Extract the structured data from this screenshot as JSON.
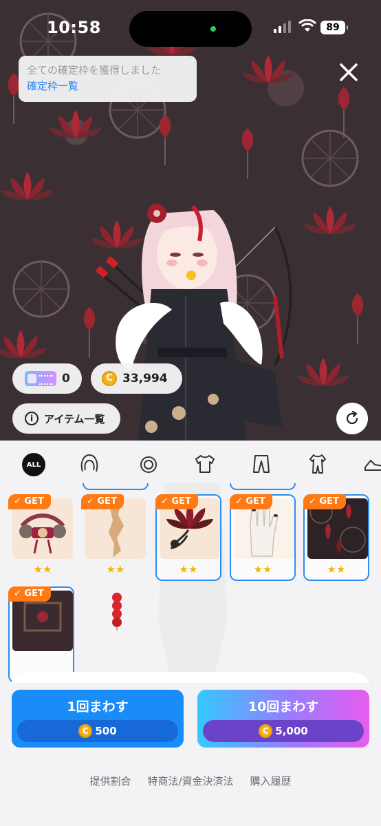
{
  "status_bar": {
    "time": "10:58",
    "battery": "89"
  },
  "notice": {
    "message": "全ての確定枠を獲得しました",
    "link": "確定枠一覧"
  },
  "currency": {
    "tickets": "0",
    "coins": "33,994",
    "coin_symbol": "C"
  },
  "item_list_label": "アイテム一覧",
  "categories": [
    {
      "name": "all",
      "label": "ALL",
      "selected": true
    },
    {
      "name": "hair",
      "icon": "hair-icon"
    },
    {
      "name": "accessory",
      "icon": "ring-icon"
    },
    {
      "name": "top",
      "icon": "shirt-icon"
    },
    {
      "name": "bottom",
      "icon": "pants-icon"
    },
    {
      "name": "bodysuit",
      "icon": "bodysuit-icon"
    },
    {
      "name": "shoes",
      "icon": "shoe-icon"
    }
  ],
  "items": [
    {
      "badge": "GET",
      "rating": "★★",
      "selected": false,
      "icon": "beaded-ornament-icon"
    },
    {
      "badge": "GET",
      "rating": "★★",
      "selected": false,
      "icon": "torn-paper-icon"
    },
    {
      "badge": "GET",
      "rating": "★★",
      "selected": true,
      "icon": "lotus-flower-icon"
    },
    {
      "badge": "GET",
      "rating": "★★",
      "selected": true,
      "icon": "glove-icon"
    },
    {
      "badge": "GET",
      "rating": "★★",
      "selected": true,
      "icon": "lotus-pattern-icon"
    },
    {
      "badge": "GET",
      "selected": true,
      "icon": "background-frame-icon"
    },
    {
      "selected": false,
      "icon": "candied-fruit-skewer-icon"
    }
  ],
  "color_swatches": [
    {
      "name": "original",
      "color": "#5a1a1f",
      "active": true
    },
    {
      "name": "green",
      "color": "#2f5a4c",
      "active": false
    },
    {
      "name": "blue",
      "color": "#1f4a78",
      "active": false
    },
    {
      "name": "purple",
      "color": "#6b5fb3",
      "active": false
    },
    {
      "name": "black",
      "color": "#3a3a3a",
      "active": false
    }
  ],
  "draw_buttons": {
    "single": {
      "label": "1回まわす",
      "price": "500"
    },
    "ten": {
      "label": "10回まわす",
      "price": "5,000"
    }
  },
  "footer_links": [
    "提供割合",
    "特商法/資金決済法",
    "購入履歴"
  ],
  "colors": {
    "accent_blue": "#2b8ef0",
    "get_badge": "#ff7a14",
    "star": "#f5b400"
  }
}
